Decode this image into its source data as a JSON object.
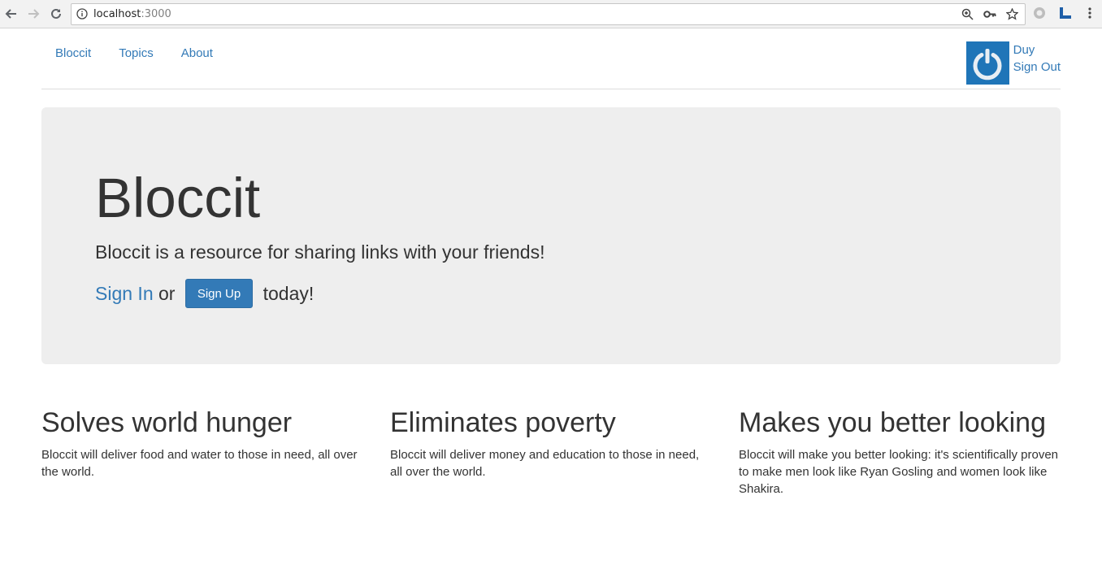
{
  "browser": {
    "url_host": "localhost",
    "url_port": ":3000"
  },
  "nav": {
    "links": [
      "Bloccit",
      "Topics",
      "About"
    ],
    "user_name": "Duy",
    "sign_out": "Sign Out"
  },
  "jumbotron": {
    "title": "Bloccit",
    "lead": "Bloccit is a resource for sharing links with your friends!",
    "sign_in": "Sign In",
    "or_text": " or ",
    "sign_up": "Sign Up",
    "today_text": " today!"
  },
  "features": [
    {
      "heading": "Solves world hunger",
      "text": "Bloccit will deliver food and water to those in need, all over the world."
    },
    {
      "heading": "Eliminates poverty",
      "text": "Bloccit will deliver money and education to those in need, all over the world."
    },
    {
      "heading": "Makes you better looking",
      "text": "Bloccit will make you better looking: it's scientifically proven to make men look like Ryan Gosling and women look like Shakira."
    }
  ],
  "colors": {
    "link": "#337ab7",
    "jumbotron_bg": "#eeeeee",
    "avatar_bg": "#1f75b8"
  }
}
